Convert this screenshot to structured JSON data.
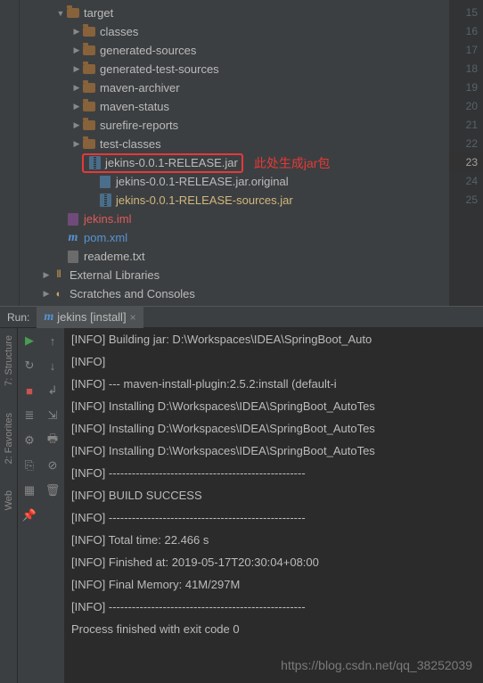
{
  "tree": {
    "target": "target",
    "classes": "classes",
    "generated_sources": "generated-sources",
    "generated_test_sources": "generated-test-sources",
    "maven_archiver": "maven-archiver",
    "maven_status": "maven-status",
    "surefire_reports": "surefire-reports",
    "test_classes": "test-classes",
    "jar": "jekins-0.0.1-RELEASE.jar",
    "jar_original": "jekins-0.0.1-RELEASE.jar.original",
    "sources_jar": "jekins-0.0.1-RELEASE-sources.jar",
    "iml": "jekins.iml",
    "pom": "pom.xml",
    "readme": "reademe.txt",
    "external_libs": "External Libraries",
    "scratches": "Scratches and Consoles"
  },
  "annotation": "此处生成jar包",
  "gutter": [
    "15",
    "16",
    "17",
    "18",
    "",
    "",
    "19",
    "20",
    "",
    "",
    "21",
    "22",
    "23",
    "24",
    "25"
  ],
  "run": {
    "label": "Run:",
    "tab": "jekins [install]"
  },
  "console_lines": [
    "[INFO] Building jar: D:\\Workspaces\\IDEA\\SpringBoot_Auto",
    "[INFO]",
    "[INFO] --- maven-install-plugin:2.5.2:install (default-i",
    "[INFO] Installing D:\\Workspaces\\IDEA\\SpringBoot_AutoTes",
    "[INFO] Installing D:\\Workspaces\\IDEA\\SpringBoot_AutoTes",
    "[INFO] Installing D:\\Workspaces\\IDEA\\SpringBoot_AutoTes",
    "[INFO] ---------------------------------------------------",
    "[INFO] BUILD SUCCESS",
    "[INFO] ---------------------------------------------------",
    "[INFO] Total time: 22.466 s",
    "[INFO] Finished at: 2019-05-17T20:30:04+08:00",
    "[INFO] Final Memory: 41M/297M",
    "[INFO] ---------------------------------------------------",
    "",
    "Process finished with exit code 0"
  ],
  "side_tabs": {
    "structure": "7: Structure",
    "favorites": "2: Favorites",
    "web": "Web"
  },
  "watermark": "https://blog.csdn.net/qq_38252039"
}
